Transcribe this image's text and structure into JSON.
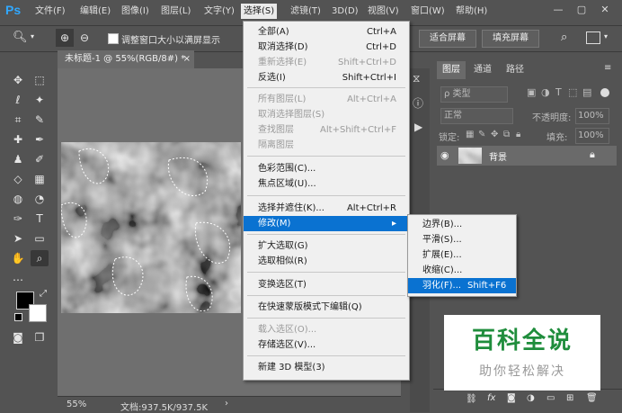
{
  "app": {
    "logo": "Ps"
  },
  "menubar": {
    "items": [
      "文件(F)",
      "编辑(E)",
      "图像(I)",
      "图层(L)",
      "文字(Y)",
      "选择(S)",
      "滤镜(T)",
      "3D(D)",
      "视图(V)",
      "窗口(W)",
      "帮助(H)"
    ],
    "active_index": 5
  },
  "options": {
    "resize_window_label": "调整窗口大小以满屏显示",
    "fit_screen_label": "适合屏幕",
    "fill_screen_label": "填充屏幕"
  },
  "document": {
    "tab_title": "未标题-1 @ 55%(RGB/8#) *",
    "zoom": "55%",
    "doc_info": "文档:937.5K/937.5K"
  },
  "select_menu": {
    "items": [
      {
        "label": "全部(A)",
        "shortcut": "Ctrl+A",
        "disabled": false
      },
      {
        "label": "取消选择(D)",
        "shortcut": "Ctrl+D",
        "disabled": false
      },
      {
        "label": "重新选择(E)",
        "shortcut": "Shift+Ctrl+D",
        "disabled": true
      },
      {
        "label": "反选(I)",
        "shortcut": "Shift+Ctrl+I",
        "disabled": false
      },
      {
        "label": "所有图层(L)",
        "shortcut": "Alt+Ctrl+A",
        "disabled": true
      },
      {
        "label": "取消选择图层(S)",
        "shortcut": "",
        "disabled": true
      },
      {
        "label": "查找图层",
        "shortcut": "Alt+Shift+Ctrl+F",
        "disabled": true
      },
      {
        "label": "隔离图层",
        "shortcut": "",
        "disabled": true
      },
      {
        "label": "色彩范围(C)...",
        "shortcut": "",
        "disabled": false
      },
      {
        "label": "焦点区域(U)...",
        "shortcut": "",
        "disabled": false
      },
      {
        "label": "选择并遮住(K)...",
        "shortcut": "Alt+Ctrl+R",
        "disabled": false
      },
      {
        "label": "修改(M)",
        "shortcut": "",
        "disabled": false
      },
      {
        "label": "扩大选取(G)",
        "shortcut": "",
        "disabled": false
      },
      {
        "label": "选取相似(R)",
        "shortcut": "",
        "disabled": false
      },
      {
        "label": "变换选区(T)",
        "shortcut": "",
        "disabled": false
      },
      {
        "label": "在快速蒙版模式下编辑(Q)",
        "shortcut": "",
        "disabled": false
      },
      {
        "label": "载入选区(O)...",
        "shortcut": "",
        "disabled": true
      },
      {
        "label": "存储选区(V)...",
        "shortcut": "",
        "disabled": false
      },
      {
        "label": "新建 3D 模型(3)",
        "shortcut": "",
        "disabled": false
      }
    ]
  },
  "modify_submenu": {
    "items": [
      {
        "label": "边界(B)...",
        "shortcut": ""
      },
      {
        "label": "平滑(S)...",
        "shortcut": ""
      },
      {
        "label": "扩展(E)...",
        "shortcut": ""
      },
      {
        "label": "收缩(C)...",
        "shortcut": ""
      },
      {
        "label": "羽化(F)...",
        "shortcut": "Shift+F6"
      }
    ]
  },
  "layers_panel": {
    "tabs": [
      "图层",
      "通道",
      "路径"
    ],
    "filter_label": "ρ 类型",
    "blend_mode": "正常",
    "opacity_label": "不透明度:",
    "opacity_value": "100%",
    "lock_label": "锁定:",
    "fill_label": "填充:",
    "fill_value": "100%",
    "layer_name": "背景"
  },
  "watermark": {
    "title": "百科全说",
    "subtitle": "助你轻松解决"
  },
  "colors": {
    "ui_bg": "#535353",
    "menu_bg": "#f0f0f0",
    "highlight": "#0a72d1",
    "watermark_green": "#1f8d3c"
  }
}
